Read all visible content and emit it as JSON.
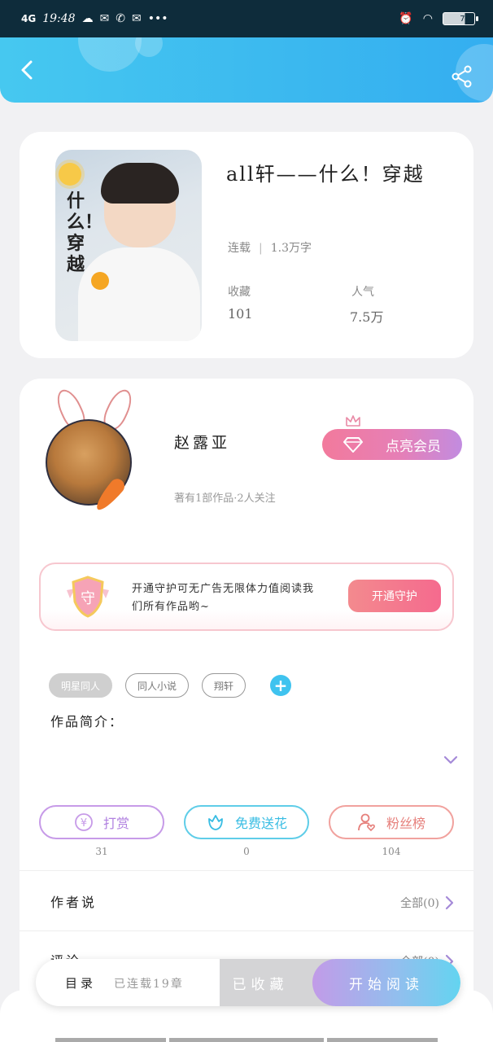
{
  "status_bar": {
    "network": "4G",
    "time": "19:48",
    "battery": "70"
  },
  "book": {
    "title": "all轩——什么！穿越",
    "cover_text": "什么！穿越",
    "status": "连载",
    "word_count": "1.3万字",
    "favorites_label": "收藏",
    "favorites_value": "101",
    "popularity_label": "人气",
    "popularity_value": "7.5万"
  },
  "author": {
    "name": "赵露亚",
    "meta": "著有1部作品·2人关注",
    "vip_label": "点亮会员"
  },
  "guard": {
    "badge": "守",
    "text": "开通守护可无广告无限体力值阅读我们所有作品哟~",
    "button": "开通守护"
  },
  "tags": [
    "明星同人",
    "同人小说",
    "翔轩"
  ],
  "intro_label": "作品简介：",
  "actions": [
    {
      "label": "打赏",
      "count": "31"
    },
    {
      "label": "免费送花",
      "count": "0"
    },
    {
      "label": "粉丝榜",
      "count": "104"
    }
  ],
  "author_says": {
    "title": "作者说",
    "all": "全部(0)"
  },
  "comments": {
    "title": "评论",
    "all": "全部(0)"
  },
  "bottom_bar": {
    "toc": "目录",
    "toc_status": "已连载19章",
    "collected": "已收藏",
    "read": "开始阅读"
  },
  "colors": {
    "header": "#3bb8ef",
    "accent_blue": "#3fc3ef",
    "vip_pink": "#f27a9c",
    "tip_purple": "#b181e0",
    "fans_red": "#e6807c"
  }
}
